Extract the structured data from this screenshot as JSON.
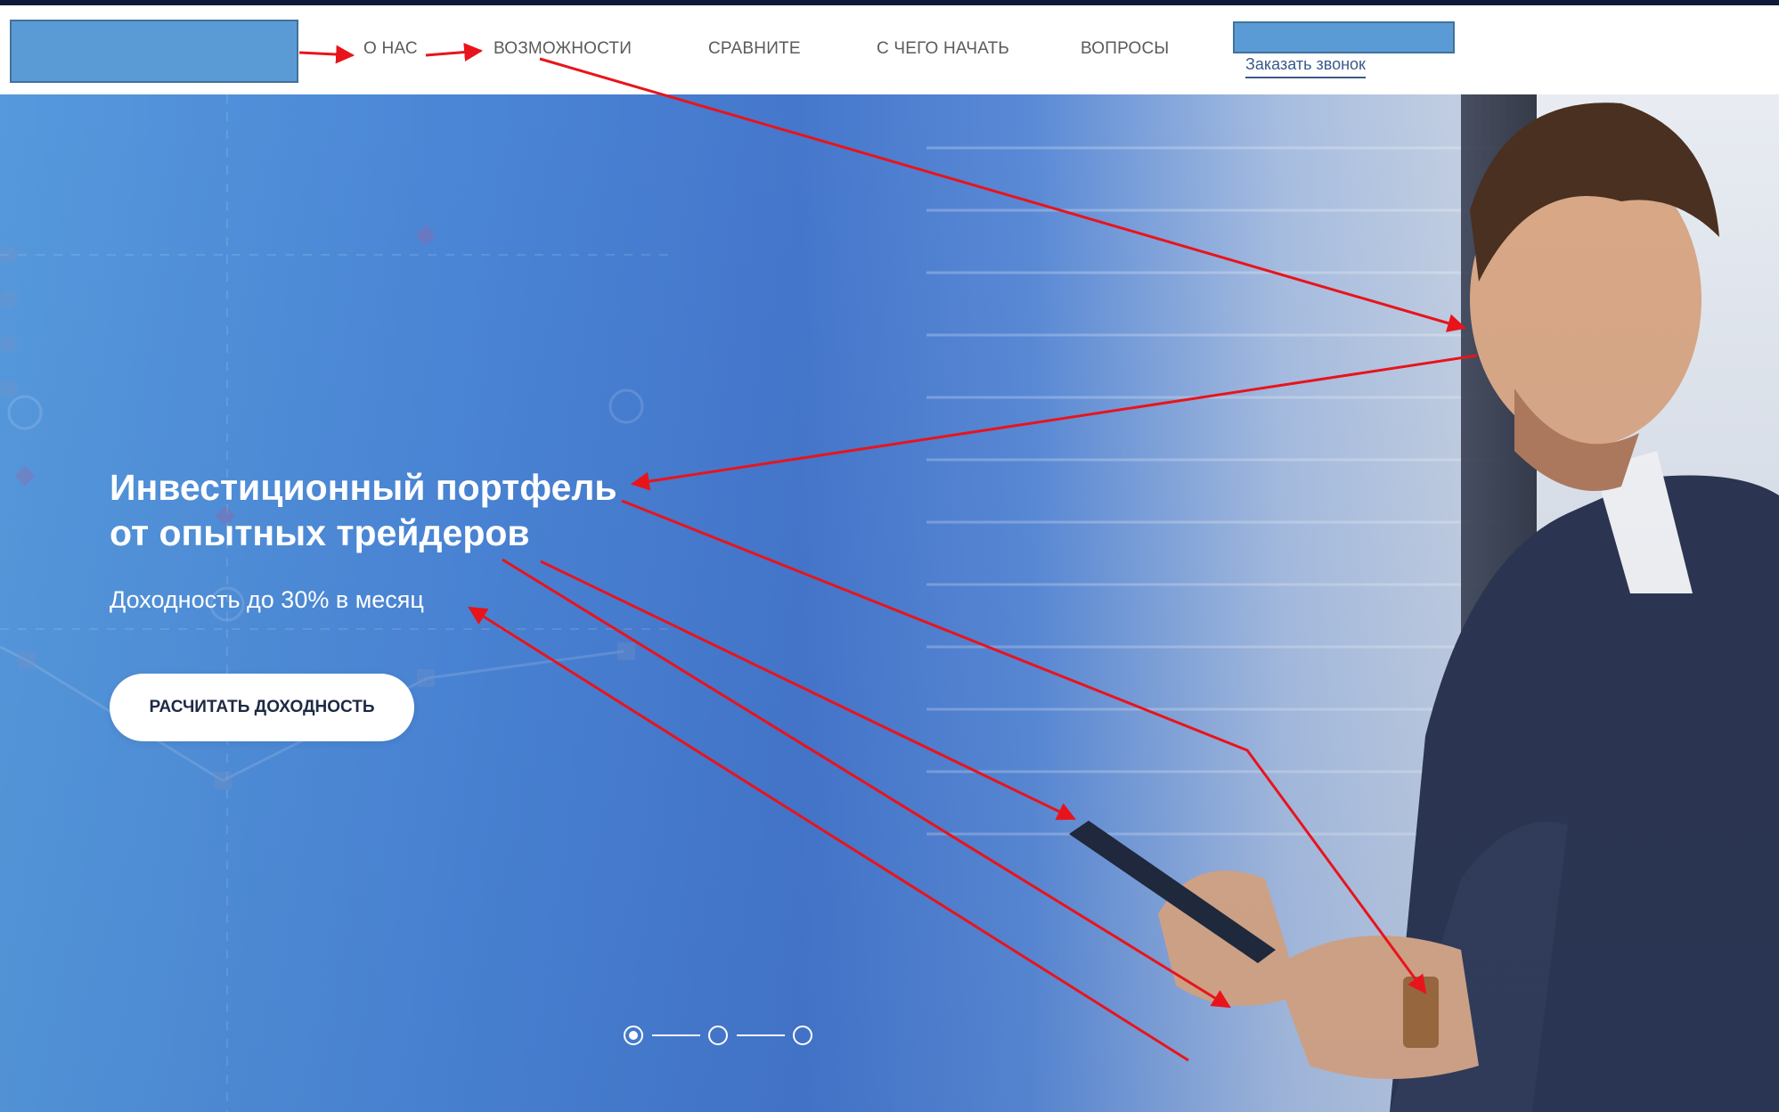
{
  "header": {
    "nav": [
      "О НАС",
      "ВОЗМОЖНОСТИ",
      "СРАВНИТЕ",
      "С ЧЕГО НАЧАТЬ",
      "ВОПРОСЫ"
    ],
    "callback_label": "Заказать звонок"
  },
  "hero": {
    "title_line1": "Инвестиционный портфель",
    "title_line2": "от опытных трейдеров",
    "subtitle": "Доходность до 30% в месяц",
    "cta_label": "РАСЧИТАТЬ ДОХОДНОСТЬ",
    "slider": {
      "total": 3,
      "active": 1
    }
  },
  "colors": {
    "placeholder_fill": "#5b9bd5",
    "annotation_arrow": "#e8141c",
    "hero_blue": "#4577cc"
  }
}
